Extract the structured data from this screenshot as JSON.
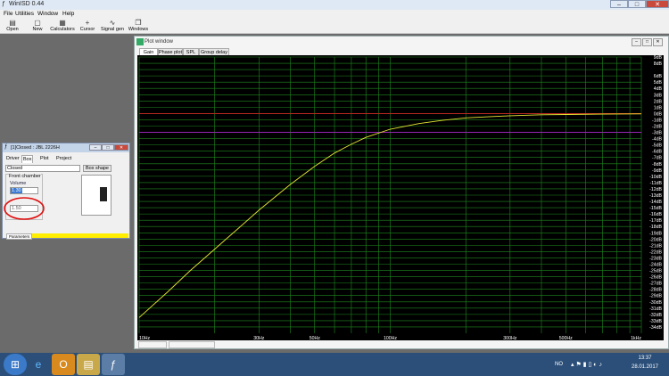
{
  "app": {
    "title": "WinISD 0.44",
    "window_buttons": [
      "–",
      "□",
      "✕"
    ]
  },
  "menu": [
    "File",
    "Utilities",
    "Window",
    "Help"
  ],
  "toolbar": [
    {
      "label": "Open",
      "icon": "folder-icon"
    },
    {
      "label": "New",
      "icon": "new-file-icon"
    },
    {
      "label": "Calculators",
      "icon": "calculator-icon"
    },
    {
      "label": "Cursor",
      "icon": "cursor-icon"
    },
    {
      "label": "Signal gen",
      "icon": "signal-gen-icon"
    },
    {
      "label": "Windows",
      "icon": "windows-icon"
    }
  ],
  "plot_window": {
    "title": "Plot window",
    "tabs": [
      "Gain",
      "Phase plot",
      "SPL",
      "Group delay"
    ],
    "selected_tab": "Gain",
    "status": [
      "",
      ""
    ]
  },
  "chart_data": {
    "type": "line",
    "x_scale": "log",
    "xlim": [
      10,
      1000
    ],
    "ylim": [
      -35,
      9
    ],
    "x_ticks": [
      {
        "v": 10,
        "label": "10Hz"
      },
      {
        "v": 30,
        "label": "30Hz"
      },
      {
        "v": 50,
        "label": "50Hz"
      },
      {
        "v": 100,
        "label": "100Hz"
      },
      {
        "v": 300,
        "label": "300Hz"
      },
      {
        "v": 500,
        "label": "500Hz"
      },
      {
        "v": 1000,
        "label": "1kHz"
      }
    ],
    "y_ticks": [
      {
        "v": 9,
        "label": "9dB"
      },
      {
        "v": 8,
        "label": "8dB"
      },
      {
        "v": 6,
        "label": "6dB"
      },
      {
        "v": 5,
        "label": "5dB"
      },
      {
        "v": 4,
        "label": "4dB"
      },
      {
        "v": 3,
        "label": "3dB"
      },
      {
        "v": 2,
        "label": "2dB"
      },
      {
        "v": 1,
        "label": "1dB"
      },
      {
        "v": 0,
        "label": "0dB"
      },
      {
        "v": -1,
        "label": "-1dB"
      },
      {
        "v": -2,
        "label": "-2dB"
      },
      {
        "v": -3,
        "label": "-3dB"
      },
      {
        "v": -4,
        "label": "-4dB"
      },
      {
        "v": -5,
        "label": "-5dB"
      },
      {
        "v": -6,
        "label": "-6dB"
      },
      {
        "v": -7,
        "label": "-7dB"
      },
      {
        "v": -8,
        "label": "-8dB"
      },
      {
        "v": -9,
        "label": "-9dB"
      },
      {
        "v": -10,
        "label": "-10dB"
      },
      {
        "v": -11,
        "label": "-11dB"
      },
      {
        "v": -12,
        "label": "-12dB"
      },
      {
        "v": -13,
        "label": "-13dB"
      },
      {
        "v": -14,
        "label": "-14dB"
      },
      {
        "v": -15,
        "label": "-15dB"
      },
      {
        "v": -16,
        "label": "-16dB"
      },
      {
        "v": -17,
        "label": "-17dB"
      },
      {
        "v": -18,
        "label": "-18dB"
      },
      {
        "v": -19,
        "label": "-19dB"
      },
      {
        "v": -20,
        "label": "-20dB"
      },
      {
        "v": -21,
        "label": "-21dB"
      },
      {
        "v": -22,
        "label": "-22dB"
      },
      {
        "v": -23,
        "label": "-23dB"
      },
      {
        "v": -24,
        "label": "-24dB"
      },
      {
        "v": -25,
        "label": "-25dB"
      },
      {
        "v": -26,
        "label": "-26dB"
      },
      {
        "v": -27,
        "label": "-27dB"
      },
      {
        "v": -28,
        "label": "-28dB"
      },
      {
        "v": -29,
        "label": "-29dB"
      },
      {
        "v": -30,
        "label": "-30dB"
      },
      {
        "v": -31,
        "label": "-31dB"
      },
      {
        "v": -32,
        "label": "-32dB"
      },
      {
        "v": -33,
        "label": "-33dB"
      },
      {
        "v": -34,
        "label": "-34dB"
      }
    ],
    "reference_lines": [
      {
        "y": 0,
        "color": "#cc2222"
      },
      {
        "y": -3,
        "color": "#aa22cc"
      }
    ],
    "series": [
      {
        "color": "#e6e633",
        "x": [
          10,
          13,
          16,
          20,
          25,
          30,
          35,
          40,
          50,
          60,
          70,
          80,
          100,
          130,
          160,
          200,
          250,
          300,
          400,
          500,
          700,
          1000
        ],
        "y": [
          -32.5,
          -28.4,
          -25.0,
          -21.6,
          -18.2,
          -15.4,
          -13.2,
          -11.3,
          -8.4,
          -6.3,
          -4.9,
          -3.8,
          -2.5,
          -1.6,
          -1.1,
          -0.7,
          -0.5,
          -0.35,
          -0.2,
          -0.15,
          -0.1,
          -0.05
        ]
      }
    ],
    "background": "#000000",
    "grid": true,
    "grid_color": "#1f8a1f"
  },
  "driver_window": {
    "title": "[1]Closed : JBL 2226H",
    "tabs": [
      "Driver",
      "Box",
      "Plot",
      "Project"
    ],
    "selected_tab": "Box",
    "box_type": "Closed",
    "box_shape_button": "Box shape",
    "group_label": "Front chamber",
    "volume_label": "Volume",
    "volume_value": "1.30",
    "second_value": "1.50",
    "bottom_tab": "Parameters"
  },
  "taskbar": {
    "lang": "NO",
    "time": "13:37",
    "date": "28.01.2017",
    "apps": [
      "windows-start-icon",
      "ie-icon",
      "outlook-icon",
      "explorer-icon",
      "winisd-icon"
    ]
  },
  "colors": {
    "highlight_circle": "#e01010",
    "taskbar": "#2b4f79"
  }
}
